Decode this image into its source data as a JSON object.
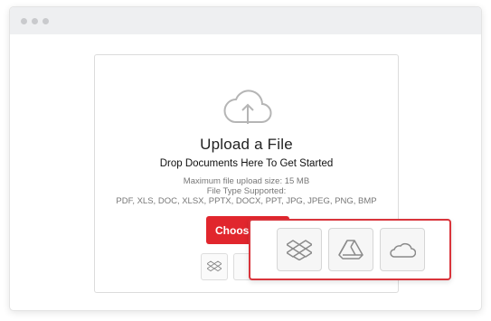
{
  "window": {
    "dots": [
      "close",
      "minimize",
      "maximize"
    ]
  },
  "upload": {
    "icon": "cloud-upload-icon",
    "title": "Upload a File",
    "subtitle": "Drop Documents Here To Get Started",
    "max_size": "Maximum file upload size: 15 MB",
    "types_label": "File Type Supported:",
    "types_list": "PDF, XLS, DOC, XLSX, PPTX, DOCX, PPT, JPG, JPEG, PNG, BMP",
    "choose_label": "Choose File"
  },
  "sources": [
    {
      "name": "dropbox",
      "icon": "dropbox-icon"
    },
    {
      "name": "google-drive",
      "icon": "google-drive-icon"
    },
    {
      "name": "onedrive",
      "icon": "onedrive-icon"
    }
  ],
  "colors": {
    "accent": "#e1262d",
    "highlight_border": "#d9343b"
  }
}
